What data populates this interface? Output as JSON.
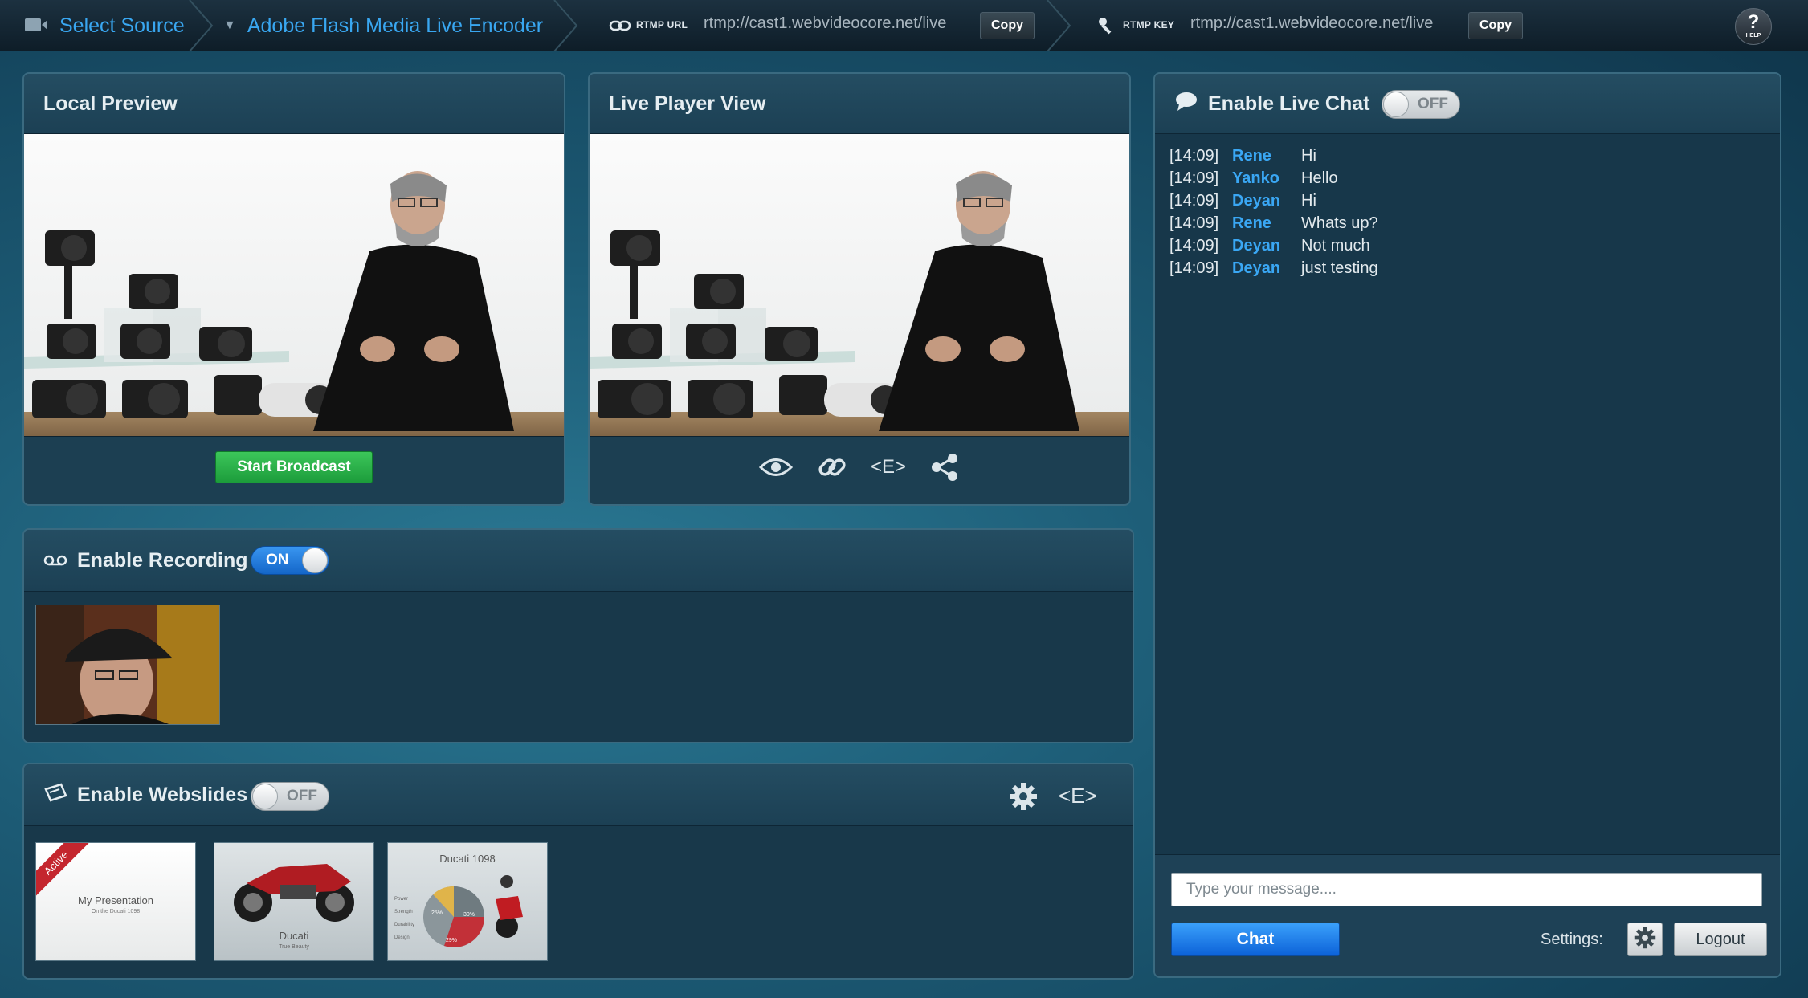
{
  "topbar": {
    "select_source": "Select Source",
    "encoder": "Adobe Flash Media Live Encoder",
    "rtmp_url_label": "RTMP URL",
    "rtmp_url_value": "rtmp://cast1.webvideocore.net/live",
    "rtmp_key_label": "RTMP KEY",
    "rtmp_key_value": "rtmp://cast1.webvideocore.net/live",
    "copy_label": "Copy",
    "help_label": "HELP"
  },
  "local_preview": {
    "title": "Local Preview",
    "start_broadcast": "Start Broadcast"
  },
  "live_player": {
    "title": "Live Player View",
    "tools": [
      "eye-icon",
      "link-icon",
      "embed-icon",
      "share-icon"
    ],
    "embed_glyph": "<E>"
  },
  "recording": {
    "title": "Enable Recording",
    "toggle": "ON"
  },
  "webslides": {
    "title": "Enable Webslides",
    "toggle": "OFF",
    "embed_glyph": "<E>",
    "slides": [
      {
        "badge": "Active",
        "title": "My Presentation",
        "subtitle": "On the Ducati 1098"
      },
      {
        "title": "Ducati",
        "subtitle": "True Beauty"
      },
      {
        "title": "Ducati 1098",
        "legend": [
          "Power",
          "Strength",
          "Durability",
          "Design"
        ],
        "pie_labels": [
          "29%",
          "30%",
          "25%"
        ]
      }
    ]
  },
  "chat": {
    "title": "Enable Live Chat",
    "toggle": "OFF",
    "messages": [
      {
        "time": "[14:09]",
        "user": "Rene",
        "text": "Hi"
      },
      {
        "time": "[14:09]",
        "user": "Yanko",
        "text": "Hello"
      },
      {
        "time": "[14:09]",
        "user": "Deyan",
        "text": "Hi"
      },
      {
        "time": "[14:09]",
        "user": "Rene",
        "text": "Whats up?"
      },
      {
        "time": "[14:09]",
        "user": "Deyan",
        "text": "Not much"
      },
      {
        "time": "[14:09]",
        "user": "Deyan",
        "text": "just testing"
      }
    ],
    "input_placeholder": "Type your message....",
    "chat_button": "Chat",
    "settings_label": "Settings:",
    "logout_button": "Logout"
  },
  "colors": {
    "accent_blue": "#39a7f1",
    "broadcast_green": "#1c9c3b",
    "chat_button_blue": "#0c62d8"
  }
}
